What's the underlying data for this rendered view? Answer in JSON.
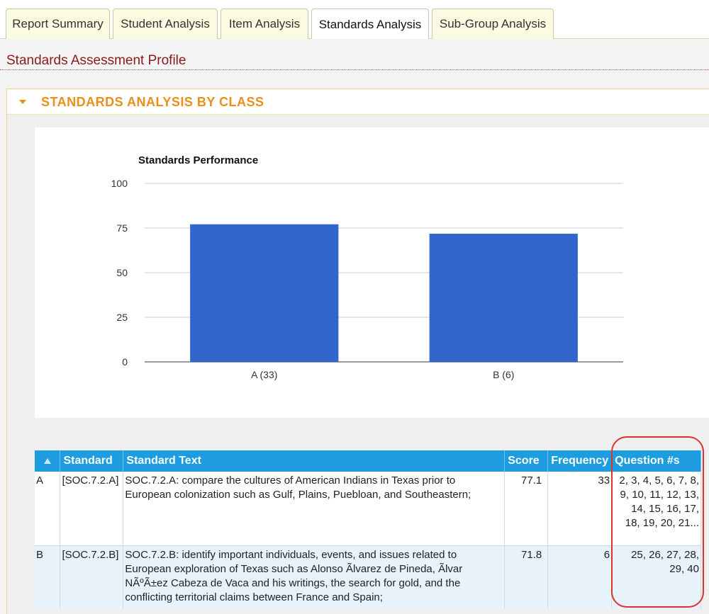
{
  "tabs": [
    {
      "label": "Report Summary",
      "active": false
    },
    {
      "label": "Student Analysis",
      "active": false
    },
    {
      "label": "Item Analysis",
      "active": false
    },
    {
      "label": "Standards Analysis",
      "active": true
    },
    {
      "label": "Sub-Group Analysis",
      "active": false
    }
  ],
  "page": {
    "title": "Standards Assessment Profile"
  },
  "panel": {
    "title": "STANDARDS ANALYSIS BY CLASS"
  },
  "chart_data": {
    "type": "bar",
    "title": "Standards Performance",
    "categories": [
      "A (33)",
      "B (6)"
    ],
    "values": [
      77.1,
      71.8
    ],
    "ylim": [
      0,
      100
    ],
    "yticks": [
      0,
      25,
      50,
      75,
      100
    ],
    "bar_color": "#3366cc",
    "grid": true
  },
  "table": {
    "headers": [
      "Standard",
      "Standard Text",
      "Score",
      "Frequency",
      "Question #s"
    ],
    "rows": [
      {
        "key": "A",
        "standard": "[SOC.7.2.A]",
        "text": "SOC.7.2.A: compare the cultures of American Indians in Texas prior to European colonization such as Gulf, Plains, Puebloan, and Southeastern;",
        "score": "77.1",
        "frequency": "33",
        "questions": "2, 3, 4, 5, 6, 7, 8, 9, 10, 11, 12, 13, 14, 15, 16, 17, 18, 19, 20, 21..."
      },
      {
        "key": "B",
        "standard": "[SOC.7.2.B]",
        "text": "SOC.7.2.B: identify important individuals, events, and issues related to European exploration of Texas such as Alonso Ãlvarez de Pineda, Ãlvar NÃºÃ±ez Cabeza de Vaca and his writings, the search for gold, and the conflicting territorial claims between France and Spain;",
        "score": "71.8",
        "frequency": "6",
        "questions": "25, 26, 27, 28, 29, 40"
      }
    ]
  }
}
